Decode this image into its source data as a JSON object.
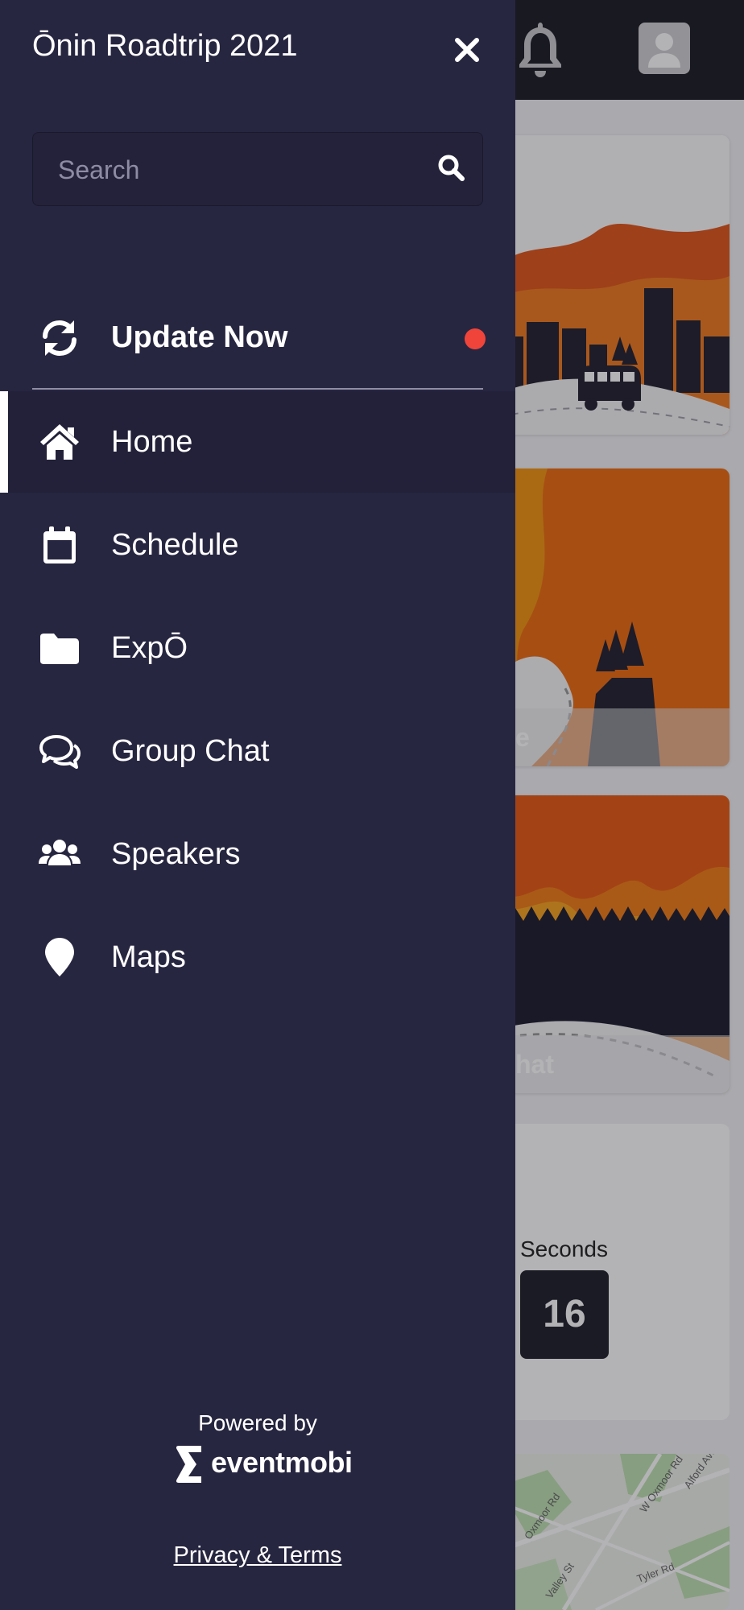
{
  "drawer": {
    "title": "Ōnin Roadtrip 2021",
    "search_placeholder": "Search",
    "update": {
      "label": "Update Now"
    },
    "items": [
      {
        "label": "Home",
        "icon": "home-icon",
        "active": true
      },
      {
        "label": "Schedule",
        "icon": "calendar-icon",
        "active": false
      },
      {
        "label": "ExpŌ",
        "icon": "folder-icon",
        "active": false
      },
      {
        "label": "Group Chat",
        "icon": "chat-icon",
        "active": false
      },
      {
        "label": "Speakers",
        "icon": "users-icon",
        "active": false
      },
      {
        "label": "Maps",
        "icon": "map-pin-icon",
        "active": false
      }
    ],
    "footer": {
      "powered_by": "Powered by",
      "brand": "eventmobi",
      "privacy": "Privacy & Terms"
    }
  },
  "background": {
    "card_labels": [
      "e",
      "hat"
    ],
    "countdown": {
      "label": "Seconds",
      "value": "16"
    },
    "map_roads": [
      "Alford Ave",
      "W Oxmoor Rd",
      "Oxmoor Rd",
      "Valley St",
      "Tyler Rd"
    ]
  },
  "colors": {
    "drawer_bg": "#272641",
    "active_item_bg": "#222139",
    "update_dot": "#f0443a",
    "header_bg": "#1c1d26"
  }
}
